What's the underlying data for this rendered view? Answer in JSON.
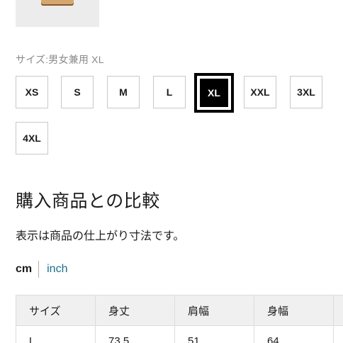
{
  "size": {
    "label": "サイズ:男女兼用 XL",
    "options": [
      "XS",
      "S",
      "M",
      "L",
      "XL",
      "XXL",
      "3XL",
      "4XL"
    ],
    "selected": "XL"
  },
  "compare": {
    "title": "購入商品との比較",
    "note": "表示は商品の仕上がり寸法です。"
  },
  "units": {
    "cm": "cm",
    "inch": "inch",
    "selected": "cm"
  },
  "table": {
    "headers": [
      "サイズ",
      "身丈",
      "肩幅",
      "身幅",
      ""
    ],
    "rows": [
      [
        "L",
        "73.5",
        "51",
        "64",
        ""
      ]
    ]
  }
}
